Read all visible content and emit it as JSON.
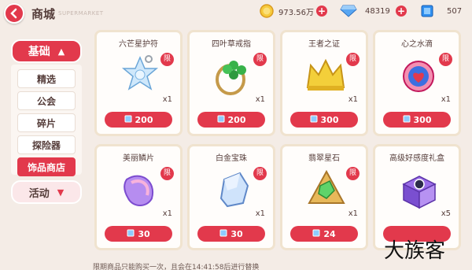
{
  "header": {
    "title": "商城",
    "subtitle": "SUPERMARKET",
    "coins": "973.56万",
    "gems": "48319",
    "blue_cubes": "507"
  },
  "sidebar": {
    "top_section": "基础",
    "items": [
      "精选",
      "公会",
      "碎片",
      "探险器",
      "饰品商店"
    ],
    "active_index": 4,
    "bottom_section": "活动"
  },
  "items": [
    {
      "name": "六芒星护符",
      "limit": "限",
      "qty": "x1",
      "price": "200",
      "icon": "snowflake-amulet-icon"
    },
    {
      "name": "四叶草戒指",
      "limit": "限",
      "qty": "x1",
      "price": "200",
      "icon": "clover-ring-icon"
    },
    {
      "name": "王者之证",
      "limit": "限",
      "qty": "x1",
      "price": "300",
      "icon": "gold-crown-icon"
    },
    {
      "name": "心之水滴",
      "limit": "限",
      "qty": "x1",
      "price": "300",
      "icon": "heart-drop-icon"
    },
    {
      "name": "美丽鳞片",
      "limit": "限",
      "qty": "x1",
      "price": "30",
      "icon": "shell-scale-icon"
    },
    {
      "name": "白金宝珠",
      "limit": "限",
      "qty": "x1",
      "price": "30",
      "icon": "crystal-gem-icon"
    },
    {
      "name": "翡翠星石",
      "limit": "限",
      "qty": "x1",
      "price": "24",
      "icon": "emerald-pendant-icon"
    },
    {
      "name": "高级好感度礼盒",
      "limit": "",
      "qty": "x5",
      "price": "",
      "icon": "gift-box-icon"
    }
  ],
  "footer_note": "限期商品只能购买一次，且会在14:41:58后进行替换",
  "watermark": "大族客",
  "colors": {
    "accent": "#e2394c",
    "text": "#553d3a",
    "card_border": "#f0e3cf"
  }
}
